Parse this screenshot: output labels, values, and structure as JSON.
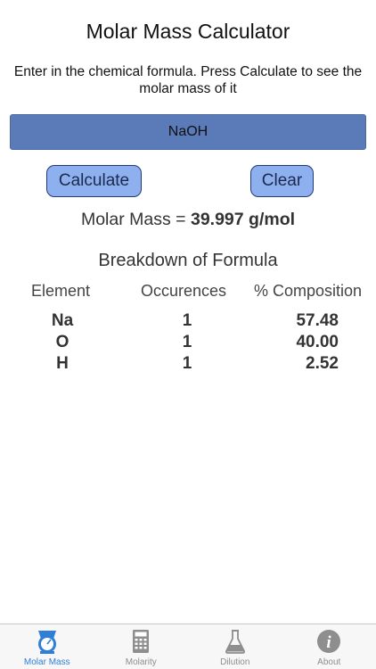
{
  "header": {
    "title": "Molar Mass Calculator",
    "instructions": "Enter in the chemical formula. Press Calculate to see the molar mass of it"
  },
  "form": {
    "formula_value": "NaOH",
    "calculate_label": "Calculate",
    "clear_label": "Clear"
  },
  "result": {
    "prefix": "Molar Mass = ",
    "value": "39.997 g/mol"
  },
  "breakdown": {
    "title": "Breakdown of Formula",
    "columns": [
      "Element",
      "Occurences",
      "% Composition"
    ],
    "rows": [
      {
        "element": "Na",
        "occurrences": "1",
        "composition": "57.48"
      },
      {
        "element": "O",
        "occurrences": "1",
        "composition": "40.00"
      },
      {
        "element": "H",
        "occurrences": "1",
        "composition": "2.52"
      }
    ]
  },
  "tabbar": {
    "active_color": "#2f7fd6",
    "inactive_color": "#8e8e8e",
    "tabs": [
      {
        "label": "Molar Mass",
        "icon": "scale-icon",
        "active": true
      },
      {
        "label": "Molarity",
        "icon": "calculator-icon",
        "active": false
      },
      {
        "label": "Dilution",
        "icon": "flask-icon",
        "active": false
      },
      {
        "label": "About",
        "icon": "info-icon",
        "active": false
      }
    ]
  }
}
